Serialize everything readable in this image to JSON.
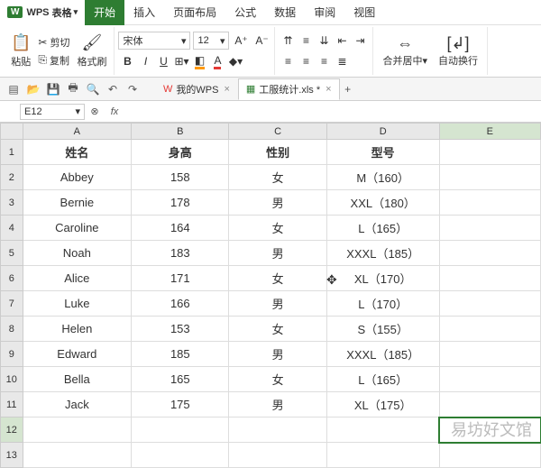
{
  "app": {
    "brand": "WPS",
    "product": "表格"
  },
  "menu": {
    "items": [
      "开始",
      "插入",
      "页面布局",
      "公式",
      "数据",
      "审阅",
      "视图"
    ],
    "activeIndex": 0
  },
  "ribbon": {
    "paste": "粘贴",
    "cut": "剪切",
    "copy": "复制",
    "format_painter": "格式刷",
    "font_name": "宋体",
    "font_size": "12",
    "merge": "合并居中",
    "wrap": "自动换行"
  },
  "doc_tabs": {
    "home": "我的WPS",
    "file": "工服统计.xls *"
  },
  "name_box": "E12",
  "columns": [
    "A",
    "B",
    "C",
    "D",
    "E"
  ],
  "row_numbers": [
    "1",
    "2",
    "3",
    "4",
    "5",
    "6",
    "7",
    "8",
    "9",
    "10",
    "11",
    "12",
    "13"
  ],
  "headers": {
    "A": "姓名",
    "B": "身高",
    "C": "性别",
    "D": "型号"
  },
  "rows": [
    {
      "A": "Abbey",
      "B": "158",
      "C": "女",
      "D": "M（160）"
    },
    {
      "A": "Bernie",
      "B": "178",
      "C": "男",
      "D": "XXL（180）"
    },
    {
      "A": "Caroline",
      "B": "164",
      "C": "女",
      "D": "L（165）"
    },
    {
      "A": "Noah",
      "B": "183",
      "C": "男",
      "D": "XXXL（185）"
    },
    {
      "A": "Alice",
      "B": "171",
      "C": "女",
      "D": "XL（170）"
    },
    {
      "A": "Luke",
      "B": "166",
      "C": "男",
      "D": "L（170）"
    },
    {
      "A": "Helen",
      "B": "153",
      "C": "女",
      "D": "S（155）"
    },
    {
      "A": "Edward",
      "B": "185",
      "C": "男",
      "D": "XXXL（185）"
    },
    {
      "A": "Bella",
      "B": "165",
      "C": "女",
      "D": "L（165）"
    },
    {
      "A": "Jack",
      "B": "175",
      "C": "男",
      "D": "XL（175）"
    }
  ],
  "selected_cell": {
    "row": 12,
    "col": "E"
  },
  "watermark": "易坊好文馆"
}
